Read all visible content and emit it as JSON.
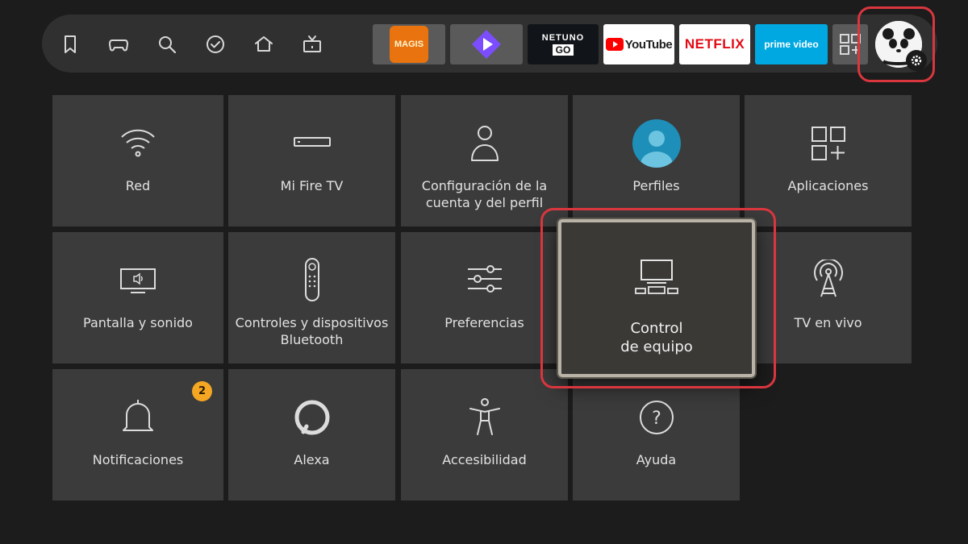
{
  "nav": {
    "icons": [
      "bookmark-icon",
      "gamepad-icon",
      "search-icon",
      "check-circle-icon",
      "home-icon",
      "live-tv-icon"
    ],
    "apps": [
      {
        "name": "magis",
        "logo": "MAGIS"
      },
      {
        "name": "play",
        "logo": ""
      },
      {
        "name": "netuno",
        "logo_top": "NETUNO",
        "logo_bottom": "GO"
      },
      {
        "name": "youtube",
        "logo": "YouTube"
      },
      {
        "name": "netflix",
        "logo": "NETFLIX"
      },
      {
        "name": "prime",
        "logo": "prime video"
      },
      {
        "name": "all-apps",
        "logo": ""
      }
    ]
  },
  "settings": {
    "tiles": [
      {
        "id": "red",
        "label": "Red",
        "icon": "wifi-icon"
      },
      {
        "id": "mi-fire-tv",
        "label": "Mi Fire TV",
        "icon": "fire-tv-device-icon"
      },
      {
        "id": "cuenta",
        "label": "Configuración de la cuenta y del perfil",
        "icon": "user-icon"
      },
      {
        "id": "perfiles",
        "label": "Perfiles",
        "icon": "profile-avatar-icon"
      },
      {
        "id": "aplicaciones",
        "label": "Aplicaciones",
        "icon": "apps-grid-icon"
      },
      {
        "id": "pantalla",
        "label": "Pantalla y sonido",
        "icon": "display-sound-icon"
      },
      {
        "id": "controles",
        "label": "Controles y dispositivos Bluetooth",
        "icon": "remote-icon"
      },
      {
        "id": "preferencias",
        "label": "Preferencias",
        "icon": "sliders-icon"
      },
      {
        "id": "control-equipo",
        "label_line1": "Control",
        "label_line2": "de equipo",
        "icon": "equipment-icon"
      },
      {
        "id": "tv-en-vivo",
        "label": "TV en vivo",
        "icon": "antenna-icon"
      },
      {
        "id": "notificaciones",
        "label": "Notificaciones",
        "icon": "bell-icon",
        "badge": "2"
      },
      {
        "id": "alexa",
        "label": "Alexa",
        "icon": "alexa-icon"
      },
      {
        "id": "accesibilidad",
        "label": "Accesibilidad",
        "icon": "accessibility-icon"
      },
      {
        "id": "ayuda",
        "label": "Ayuda",
        "icon": "help-icon"
      }
    ]
  },
  "colors": {
    "background": "#1c1c1c",
    "tile": "#3b3b3b",
    "highlight": "#d9363e",
    "badge": "#f5a623",
    "netflix": "#e50914",
    "prime": "#00a8e1"
  }
}
